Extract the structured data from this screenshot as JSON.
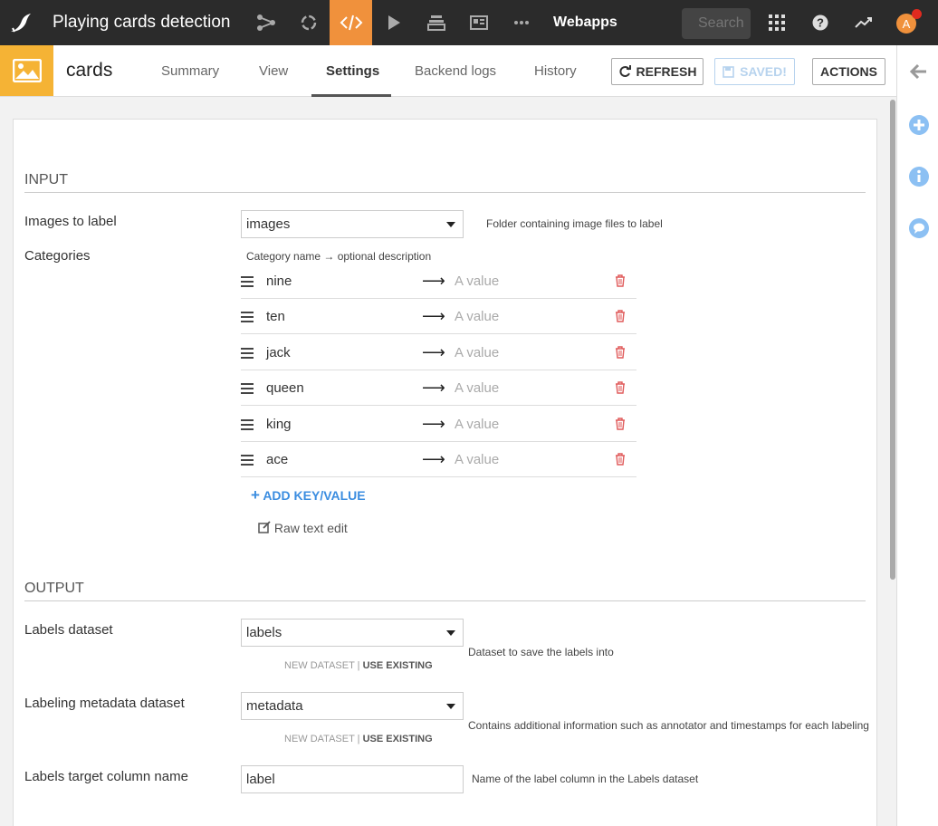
{
  "topbar": {
    "project_title": "Playing cards detection",
    "section_label": "Webapps",
    "search_placeholder": "Search",
    "avatar_letter": "A"
  },
  "header": {
    "object_name": "cards",
    "tabs": [
      {
        "label": "Summary"
      },
      {
        "label": "View"
      },
      {
        "label": "Settings",
        "active": true
      },
      {
        "label": "Backend logs"
      },
      {
        "label": "History"
      }
    ],
    "refresh_label": "REFRESH",
    "saved_label": "SAVED!",
    "actions_label": "ACTIONS"
  },
  "input_section": {
    "title": "INPUT",
    "images_label": "Images to label",
    "images_value": "images",
    "images_help": "Folder containing image files to label",
    "categories_label": "Categories",
    "categories_hint": "Category name → optional description",
    "categories": [
      {
        "key": "nine",
        "value_placeholder": "A value"
      },
      {
        "key": "ten",
        "value_placeholder": "A value"
      },
      {
        "key": "jack",
        "value_placeholder": "A value"
      },
      {
        "key": "queen",
        "value_placeholder": "A value"
      },
      {
        "key": "king",
        "value_placeholder": "A value"
      },
      {
        "key": "ace",
        "value_placeholder": "A value"
      }
    ],
    "add_kv_label": "ADD KEY/VALUE",
    "raw_edit_label": "Raw text edit"
  },
  "output_section": {
    "title": "OUTPUT",
    "labels_dataset_label": "Labels dataset",
    "labels_dataset_value": "labels",
    "labels_dataset_help": "Dataset to save the labels into",
    "new_dataset": "NEW DATASET",
    "use_existing": "USE EXISTING",
    "metadata_label": "Labeling metadata dataset",
    "metadata_value": "metadata",
    "metadata_help": "Contains additional information such as annotator and timestamps for each labeling",
    "target_col_label": "Labels target column name",
    "target_col_value": "label",
    "target_col_help": "Name of the label column in the Labels dataset"
  },
  "colors": {
    "topbar_bg": "#2b2b2b",
    "active_nav": "#f0913c",
    "object_icon_bg": "#f5b335",
    "link_blue": "#3b8de0",
    "trash_red": "#e05a5a"
  }
}
